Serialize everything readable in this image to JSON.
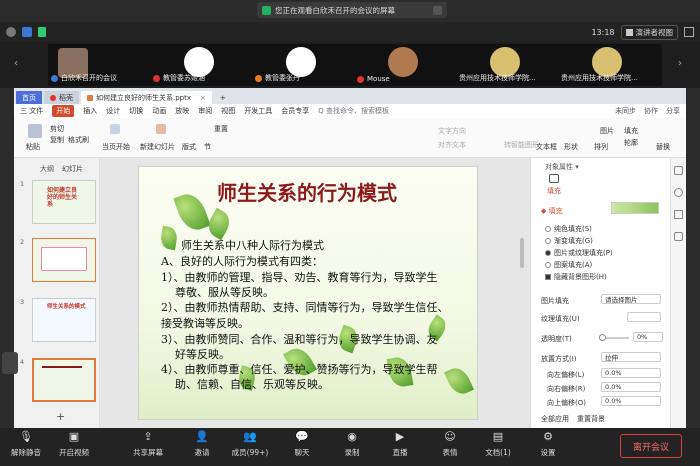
{
  "banner": {
    "text": "您正在观看白欣禾召开的会议的屏幕"
  },
  "topbar": {
    "timer": "13:18",
    "speaker_view": "演讲者视图"
  },
  "participants": [
    {
      "name": "白欣禾召开的会议"
    },
    {
      "name": "教管委苏姬涵"
    },
    {
      "name": "教管委张丹"
    },
    {
      "name": "Mouse"
    },
    {
      "name": "贵州应用技术技师学院..."
    },
    {
      "name": "贵州应用技术技师学院..."
    }
  ],
  "app": {
    "tabs": [
      {
        "label": "首页"
      },
      {
        "label": "稻壳"
      },
      {
        "label": "如何建立良好的师生关系.pptx"
      }
    ],
    "new_tab": "+",
    "menu": {
      "file": "三 文件",
      "items": [
        "开始",
        "插入",
        "设计",
        "切换",
        "动画",
        "放映",
        "审阅",
        "视图",
        "开发工具",
        "会员专享"
      ],
      "search": "Q 查找命令、搜索模板",
      "right": [
        "未同步",
        "协作",
        "分享"
      ]
    },
    "ribbon": {
      "cut": "剪切",
      "paste": "粘贴",
      "copy": "复制",
      "format_painter": "格式刷",
      "from_current": "当页开始",
      "new_slide": "新建幻灯片",
      "layout": "版式",
      "section": "节",
      "reset": "重置",
      "textbox": "文本框",
      "shape": "形状",
      "arrange": "排列",
      "picture": "图片",
      "fill": "填充",
      "outline": "轮廓",
      "replace": "替换",
      "convert_smartart": "转智能图形",
      "text_direction": "文字方向",
      "align_text": "对齐文本"
    },
    "left_tabs": [
      "大纲",
      "幻灯片"
    ],
    "thumbs": [
      {
        "num": "1",
        "title": "如何建立良好的师生关系"
      },
      {
        "num": "2",
        "title": ""
      },
      {
        "num": "3",
        "title": "师生关系的模式"
      },
      {
        "num": "4",
        "title": ""
      }
    ],
    "add_slide": "+",
    "slide": {
      "title": "师生关系的行为模式",
      "lines": [
        "师生关系中八种人际行为模式",
        "A、良好的人际行为模式有四类：",
        "1）、由教师的管理、指导、劝告、教育等行为，导致学生",
        "尊敬、服从等反映。",
        "2）、由教师热情帮助、支持、同情等行为，导致学生信任、",
        "接受教诲等反映。",
        "3）、由教师赞同、合作、温和等行为，导致学生协调、友",
        "好等反映。",
        "4）、由教师尊重、信任、爱护、赞扬等行为，导致学生帮",
        "助、信赖、自信、乐观等反映。"
      ]
    },
    "props": {
      "title": "对象属性 ▾",
      "tab_fill": "填充",
      "fill_header": "◆ 填充",
      "options": [
        {
          "label": "纯色填充(S)",
          "on": false
        },
        {
          "label": "渐变填充(G)",
          "on": false
        },
        {
          "label": "图片或纹理填充(P)",
          "on": true
        },
        {
          "label": "图案填充(A)",
          "on": false
        }
      ],
      "hide_bg": "隐藏背景图形(H)",
      "picture_fill": "图片填充",
      "picture_fill_val": "请选择图片",
      "texture_fill": "纹理填充(U)",
      "transparency": "透明度(T)",
      "transparency_val": "0%",
      "placement": "放置方式(I)",
      "placement_val": "拉伸",
      "left_offset": "向左偏移(L)",
      "left_offset_val": "0.0%",
      "right_offset": "向右偏移(R)",
      "right_offset_val": "0.0%",
      "up_offset": "向上偏移(O)",
      "up_offset_val": "0.0%",
      "apply_all": "全部应用",
      "reset_bg": "重置背景"
    }
  },
  "bottom": {
    "items": [
      "解除静音",
      "开启视频",
      "共享屏幕",
      "邀请",
      "成员(99+)",
      "聊天",
      "录制",
      "直播",
      "表情",
      "文档(1)",
      "设置"
    ],
    "leave": "离开会议"
  }
}
